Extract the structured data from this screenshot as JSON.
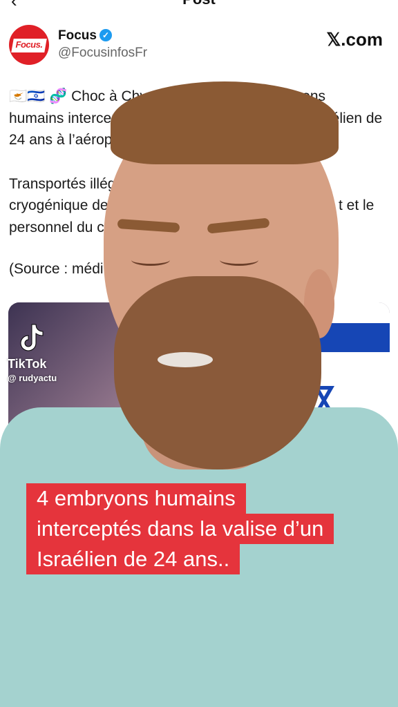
{
  "header": {
    "title": "Post"
  },
  "account": {
    "avatar_text": "Focus.",
    "name": "Focus",
    "handle": "@FocusinfosFr",
    "platform": "𝕏.com"
  },
  "post": {
    "lines": [
      "🇨🇾🇮🇱 🧬 Choc à Chypre",
      "bryons",
      "humains interceptés",
      "aélien de",
      "24 ans à l’aéropor",
      "Transportés illég",
      "cryogénique de",
      "t et le",
      "personnel du ce",
      "(Source : médi"
    ]
  },
  "watermark": {
    "brand": "TikTok",
    "user": "@ rudyactu"
  },
  "caption": {
    "lines": [
      "4 embryons humains",
      "interceptés dans la valise d’un",
      "Israélien de 24 ans.."
    ]
  },
  "colors": {
    "caption_bg": "#e5343c",
    "brand_red": "#e02027",
    "verified_blue": "#1d9bf0"
  }
}
